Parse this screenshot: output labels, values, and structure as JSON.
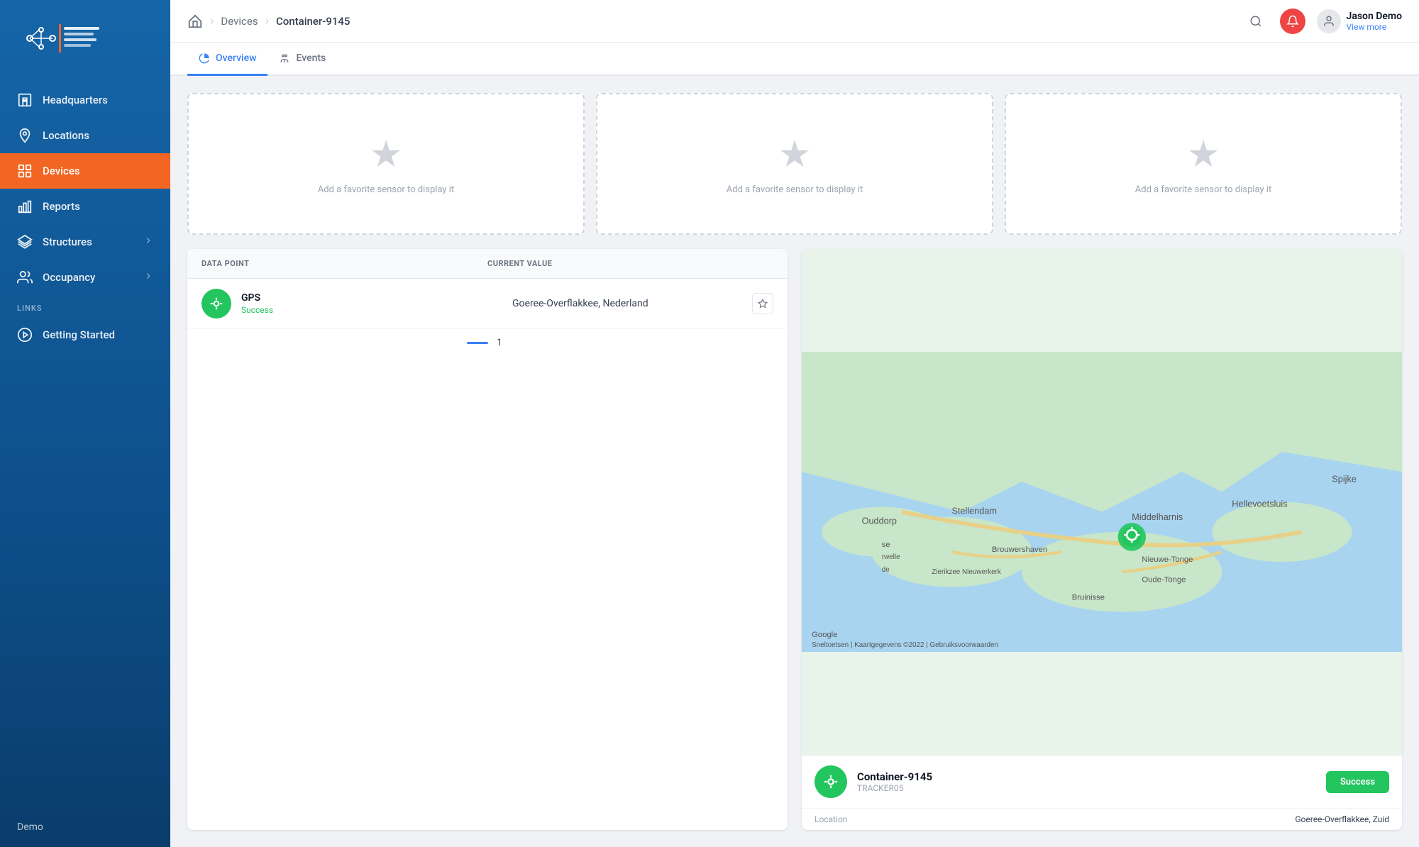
{
  "sidebar": {
    "nav_items": [
      {
        "id": "headquarters",
        "label": "Headquarters",
        "icon": "building",
        "active": false
      },
      {
        "id": "locations",
        "label": "Locations",
        "icon": "map-pin",
        "active": false
      },
      {
        "id": "devices",
        "label": "Devices",
        "icon": "grid",
        "active": true
      },
      {
        "id": "reports",
        "label": "Reports",
        "icon": "bar-chart",
        "active": false
      },
      {
        "id": "structures",
        "label": "Structures",
        "icon": "layers",
        "active": false
      },
      {
        "id": "occupancy",
        "label": "Occupancy",
        "icon": "users",
        "active": false
      }
    ],
    "links_section": "LINKS",
    "links": [
      {
        "id": "getting-started",
        "label": "Getting Started"
      }
    ],
    "bottom_label": "Demo"
  },
  "topbar": {
    "breadcrumb": [
      {
        "id": "home",
        "label": "Home",
        "is_home": true
      },
      {
        "id": "devices",
        "label": "Devices"
      },
      {
        "id": "container",
        "label": "Container-9145",
        "active": true
      }
    ],
    "user": {
      "name": "Jason Demo",
      "sub_label": "View more"
    }
  },
  "tabs": [
    {
      "id": "overview",
      "label": "Overview",
      "active": true
    },
    {
      "id": "events",
      "label": "Events",
      "active": false
    }
  ],
  "favorite_cards": [
    {
      "id": "fav1",
      "text": "Add a favorite sensor to display it"
    },
    {
      "id": "fav2",
      "text": "Add a favorite sensor to display it"
    },
    {
      "id": "fav3",
      "text": "Add a favorite sensor to display it"
    }
  ],
  "data_table": {
    "col_data_point": "DATA POINT",
    "col_current_value": "CURRENT VALUE",
    "rows": [
      {
        "id": "gps-row",
        "name": "GPS",
        "status": "Success",
        "current_value": "Goeree-Overflakkee, Nederland"
      }
    ],
    "pagination_page": "1"
  },
  "map": {
    "device_name": "Container-9145",
    "device_type": "TRACKER05",
    "status": "Success",
    "location_label": "Location",
    "location_value": "Goeree-Overflakkee, Zuid"
  }
}
